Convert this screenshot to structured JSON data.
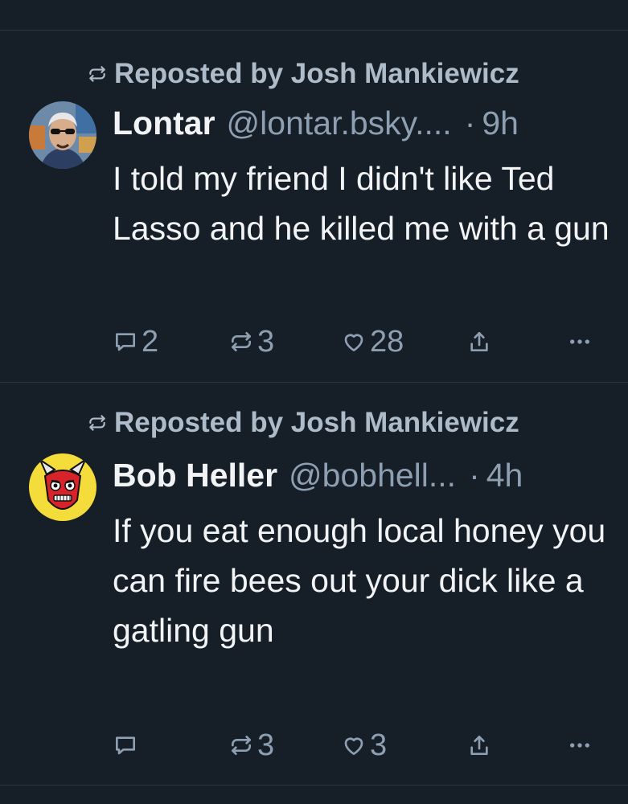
{
  "feed": {
    "posts": [
      {
        "repost_label": "Reposted by Josh Mankiewicz",
        "author_name": "Lontar",
        "handle": "@lontar.bsky....",
        "separator": "·",
        "age": "9h",
        "text": "I told my friend I didn't like Ted Lasso and he killed me with a gun",
        "replies": "2",
        "reposts": "3",
        "likes": "28"
      },
      {
        "repost_label": "Reposted by Josh Mankiewicz",
        "author_name": "Bob Heller",
        "handle": "@bobhell...",
        "separator": "·",
        "age": "4h",
        "text": "If you eat enough local honey you can fire bees out your dick like a gatling gun",
        "replies": "",
        "reposts": "3",
        "likes": "3"
      }
    ]
  },
  "icons": {
    "repost": "repost-icon",
    "reply": "reply-icon",
    "like": "heart-icon",
    "share": "share-icon",
    "more": "more-icon"
  },
  "colors": {
    "background": "#161e27",
    "divider": "#2b3642",
    "text": "#f1f3f5",
    "muted": "#8d9fb1",
    "repost_label": "#aebbc9"
  }
}
